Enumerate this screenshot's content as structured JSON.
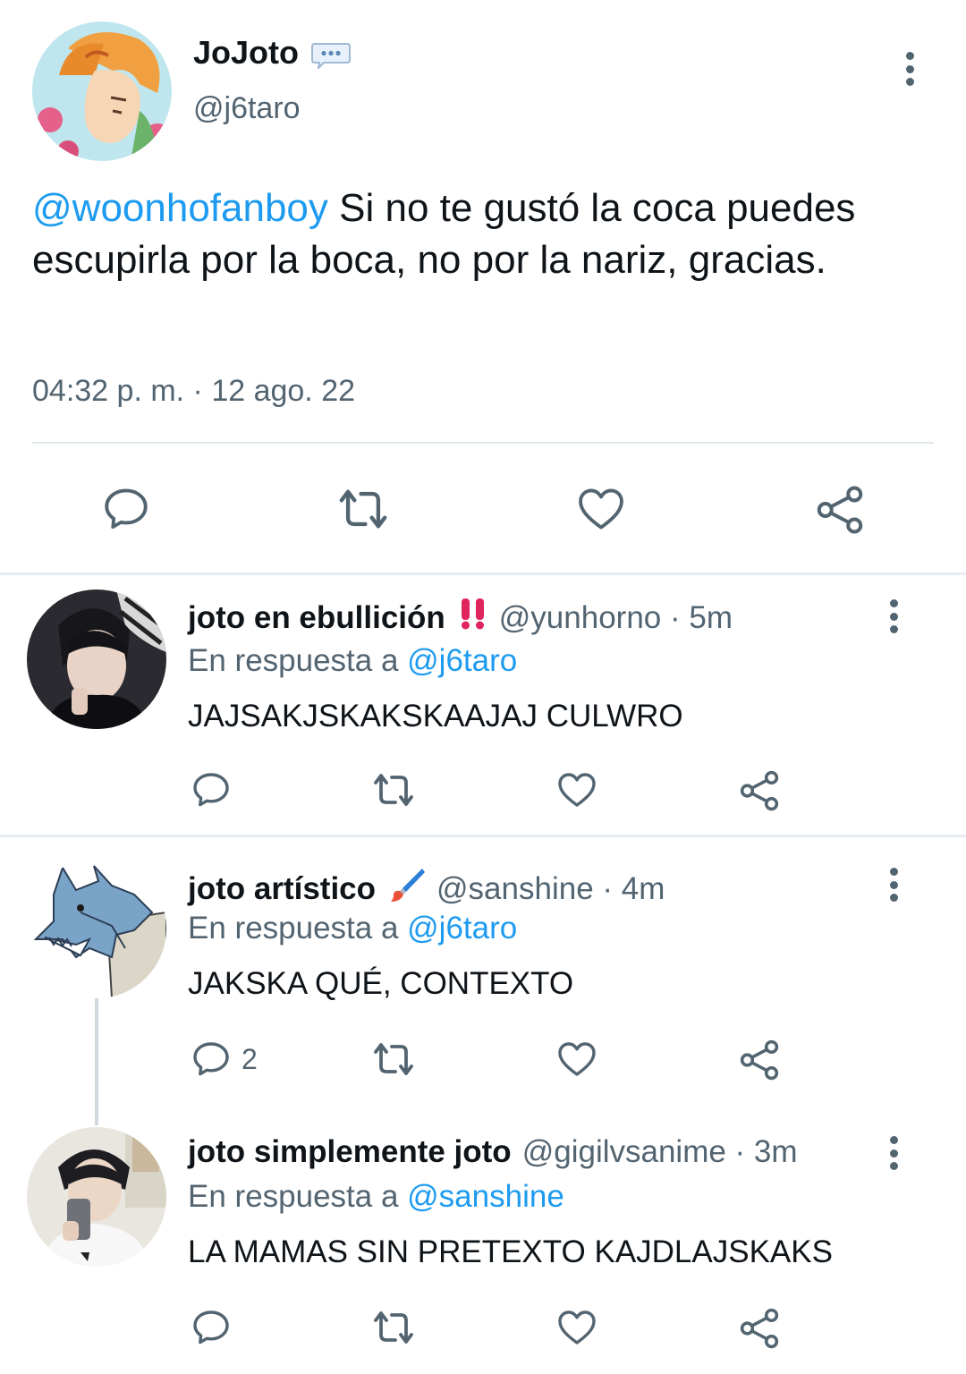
{
  "main_tweet": {
    "display_name": "JoJoto",
    "name_badge_icon": "speech-bubble-emoji",
    "handle": "@j6taro",
    "mention": "@woonhofanboy",
    "text": " Si no te gustó la coca puedes escupirla por la boca, no por la nariz, gracias.",
    "timestamp": "04:32 p. m. · 12 ago. 22"
  },
  "replies": [
    {
      "display_name": "joto en ebullición",
      "emoji": "‼️",
      "handle_time": "@yunhorno · 5m",
      "replying_prefix": "En respuesta a ",
      "replying_to": "@j6taro",
      "text": "JAJSAKJSKAKSKAAJAJ CULWRO",
      "reply_count": ""
    },
    {
      "display_name": "joto artístico",
      "emoji": "🖌️",
      "handle_time": "@sanshine · 4m",
      "replying_prefix": "En respuesta a ",
      "replying_to": "@j6taro",
      "text": "JAKSKA QUÉ, CONTEXTO",
      "reply_count": "2"
    },
    {
      "display_name": "joto simplemente joto",
      "emoji": "",
      "handle_time": "@gigilvsanime · 3m",
      "replying_prefix": "En respuesta a ",
      "replying_to": "@sanshine",
      "text": "LA MAMAS SIN PRETEXTO KAJDLAJSKAKS",
      "reply_count": ""
    }
  ],
  "icons": {
    "reply": "reply-icon",
    "retweet": "retweet-icon",
    "like": "heart-icon",
    "share": "share-icon",
    "more": "more-vertical-icon"
  },
  "colors": {
    "link": "#1d9bf0",
    "secondary_text": "#536471",
    "primary_text": "#0f1419",
    "divider": "#e6ecf0"
  }
}
